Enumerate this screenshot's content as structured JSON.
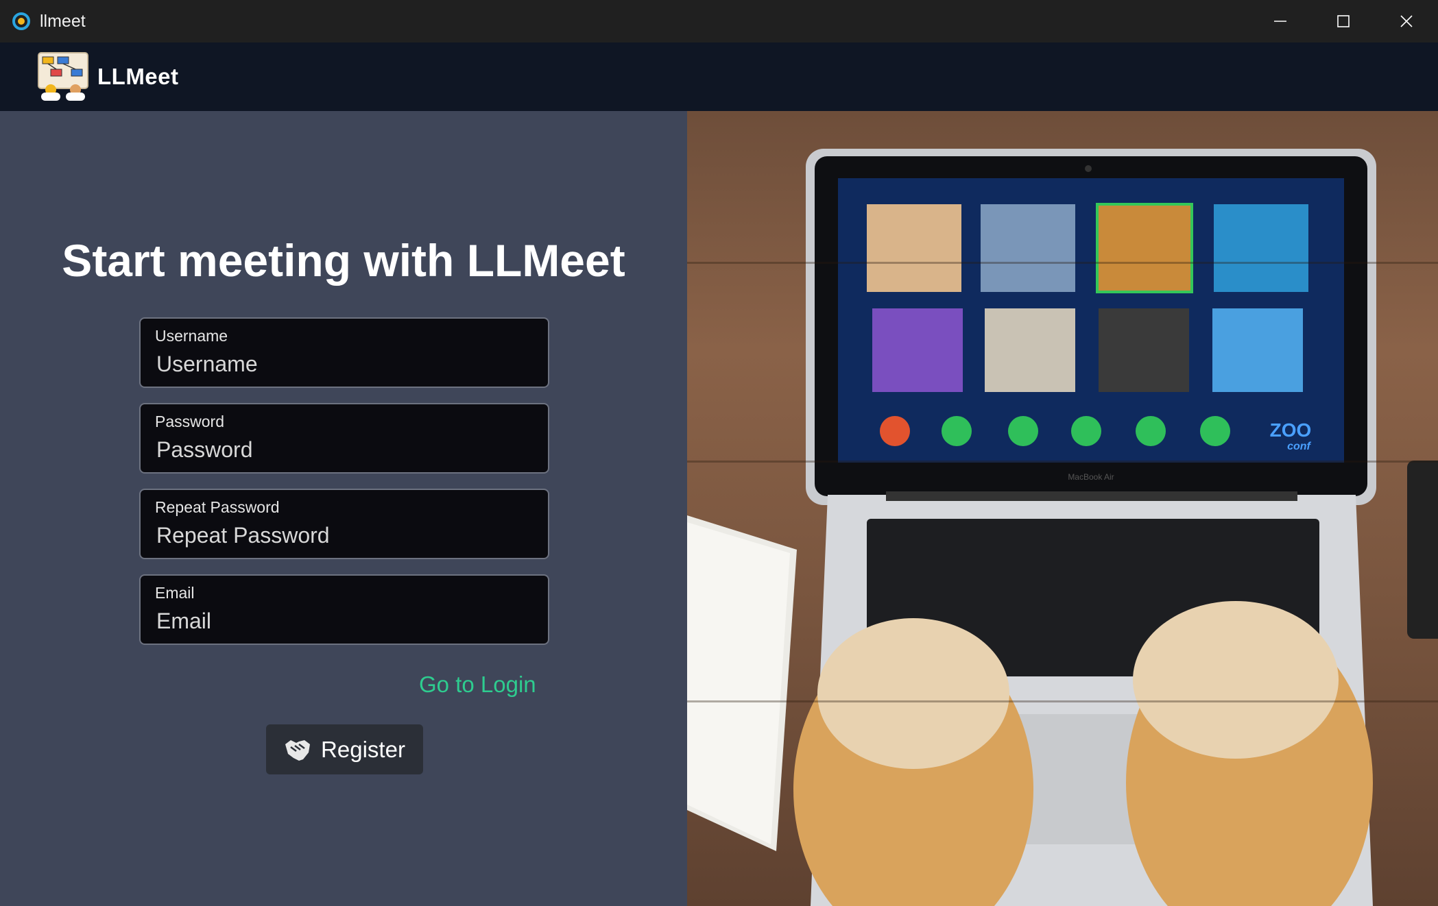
{
  "window": {
    "title": "llmeet",
    "controls": [
      "minimize-icon",
      "maximize-icon",
      "close-icon"
    ]
  },
  "header": {
    "brand": "LLMeet"
  },
  "form": {
    "headline": "Start meeting with LLMeet",
    "fields": [
      {
        "label": "Username",
        "placeholder": "Username",
        "value": ""
      },
      {
        "label": "Password",
        "placeholder": "Password",
        "value": ""
      },
      {
        "label": "Repeat Password",
        "placeholder": "Repeat Password",
        "value": ""
      },
      {
        "label": "Email",
        "placeholder": "Email",
        "value": ""
      }
    ],
    "login_link": "Go to Login",
    "register_label": "Register",
    "register_icon": "handshake-icon"
  },
  "illustration": {
    "laptop_brand": "MacBook Air",
    "conf_logo_line1": "ZOO",
    "conf_logo_line2": "conf"
  },
  "colors": {
    "link": "#2ecc8f",
    "panel": "#3f4659",
    "header": "#0f1624"
  }
}
